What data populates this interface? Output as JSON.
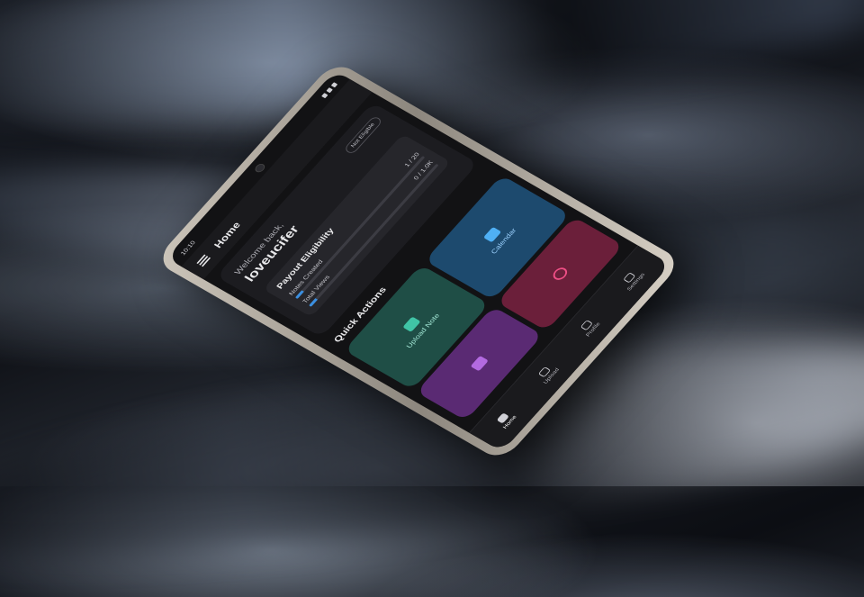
{
  "status_bar": {
    "time": "10:10"
  },
  "app_bar": {
    "title": "Home"
  },
  "welcome": {
    "label": "Welcome back,",
    "username": "loveucifer",
    "badge": "Not Eligible"
  },
  "payout": {
    "title": "Payout Eligibility",
    "metrics": [
      {
        "label": "Notes Created",
        "value": "1 / 20",
        "progress": 0.05
      },
      {
        "label": "Total Views",
        "value": "0 / 1.0K",
        "progress": 0.05
      }
    ]
  },
  "quick_actions": {
    "title": "Quick Actions",
    "tiles": [
      {
        "label": "Upload Note",
        "icon": "upload-note-icon"
      },
      {
        "label": "Calendar",
        "icon": "calendar-icon"
      },
      {
        "label": "",
        "icon": "documents-icon"
      },
      {
        "label": "",
        "icon": "search-icon"
      }
    ]
  },
  "bottom_nav": {
    "items": [
      {
        "label": "Home",
        "icon": "home-icon"
      },
      {
        "label": "Upload",
        "icon": "upload-cloud-icon"
      },
      {
        "label": "Profile",
        "icon": "profile-icon"
      },
      {
        "label": "Settings",
        "icon": "settings-icon"
      }
    ]
  },
  "colors": {
    "accent": "#3b8fe0",
    "upload_tile": "#1f4e46",
    "calendar_tile": "#1d4a6e",
    "docs_tile": "#5a2a73",
    "search_tile": "#6b1f3a"
  }
}
